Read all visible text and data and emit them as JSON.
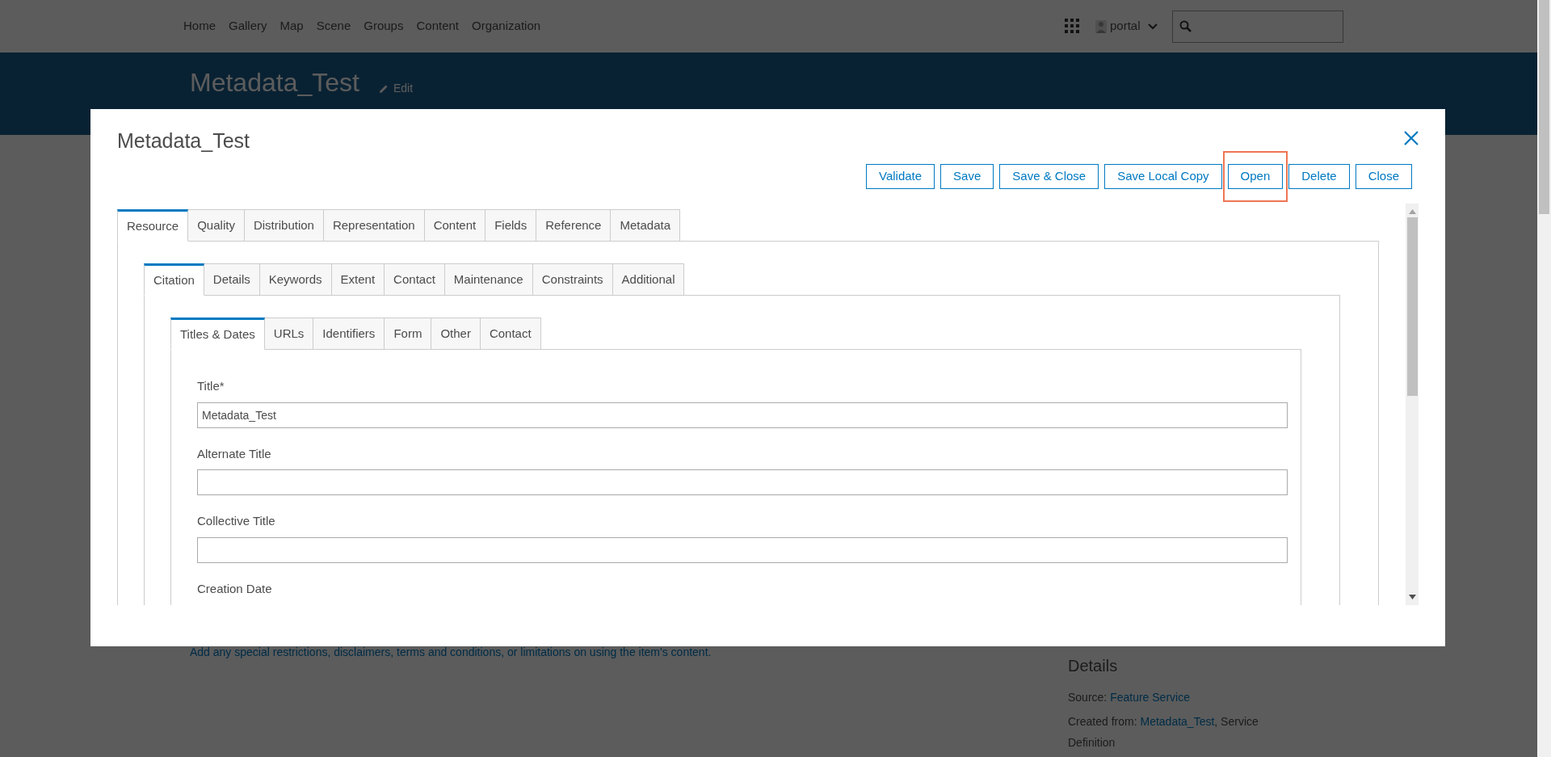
{
  "nav": {
    "links": [
      "Home",
      "Gallery",
      "Map",
      "Scene",
      "Groups",
      "Content",
      "Organization"
    ],
    "user": "portal"
  },
  "banner": {
    "title": "Metadata_Test",
    "edit": "Edit"
  },
  "page": {
    "description": "Add any special restrictions, disclaimers, terms and conditions, or limitations on using the item's content.",
    "details": {
      "heading": "Details",
      "rows": [
        {
          "label": "Source: ",
          "link": "Feature Service"
        },
        {
          "label": "Created from: ",
          "link": "Metadata_Test",
          "suffix": ", Service Definition"
        }
      ]
    }
  },
  "dialog": {
    "title": "Metadata_Test",
    "buttons": [
      {
        "label": "Validate",
        "highlighted": false
      },
      {
        "label": "Save",
        "highlighted": false
      },
      {
        "label": "Save & Close",
        "highlighted": false
      },
      {
        "label": "Save Local Copy",
        "highlighted": false
      },
      {
        "label": "Open",
        "highlighted": true
      },
      {
        "label": "Delete",
        "highlighted": false
      },
      {
        "label": "Close",
        "highlighted": false
      }
    ],
    "tab_levels": [
      {
        "tabs": [
          {
            "label": "Resource",
            "selected": true
          },
          {
            "label": "Quality",
            "selected": false
          },
          {
            "label": "Distribution",
            "selected": false
          },
          {
            "label": "Representation",
            "selected": false
          },
          {
            "label": "Content",
            "selected": false
          },
          {
            "label": "Fields",
            "selected": false
          },
          {
            "label": "Reference",
            "selected": false
          },
          {
            "label": "Metadata",
            "selected": false
          }
        ]
      },
      {
        "tabs": [
          {
            "label": "Citation",
            "selected": true
          },
          {
            "label": "Details",
            "selected": false
          },
          {
            "label": "Keywords",
            "selected": false
          },
          {
            "label": "Extent",
            "selected": false
          },
          {
            "label": "Contact",
            "selected": false
          },
          {
            "label": "Maintenance",
            "selected": false
          },
          {
            "label": "Constraints",
            "selected": false
          },
          {
            "label": "Additional",
            "selected": false
          }
        ]
      },
      {
        "tabs": [
          {
            "label": "Titles & Dates",
            "selected": true
          },
          {
            "label": "URLs",
            "selected": false
          },
          {
            "label": "Identifiers",
            "selected": false
          },
          {
            "label": "Form",
            "selected": false
          },
          {
            "label": "Other",
            "selected": false
          },
          {
            "label": "Contact",
            "selected": false
          }
        ]
      }
    ],
    "fields": [
      {
        "label": "Title*",
        "value": "Metadata_Test"
      },
      {
        "label": "Alternate Title"
      },
      {
        "label": "Collective Title"
      }
    ],
    "next_label": "Creation Date"
  }
}
